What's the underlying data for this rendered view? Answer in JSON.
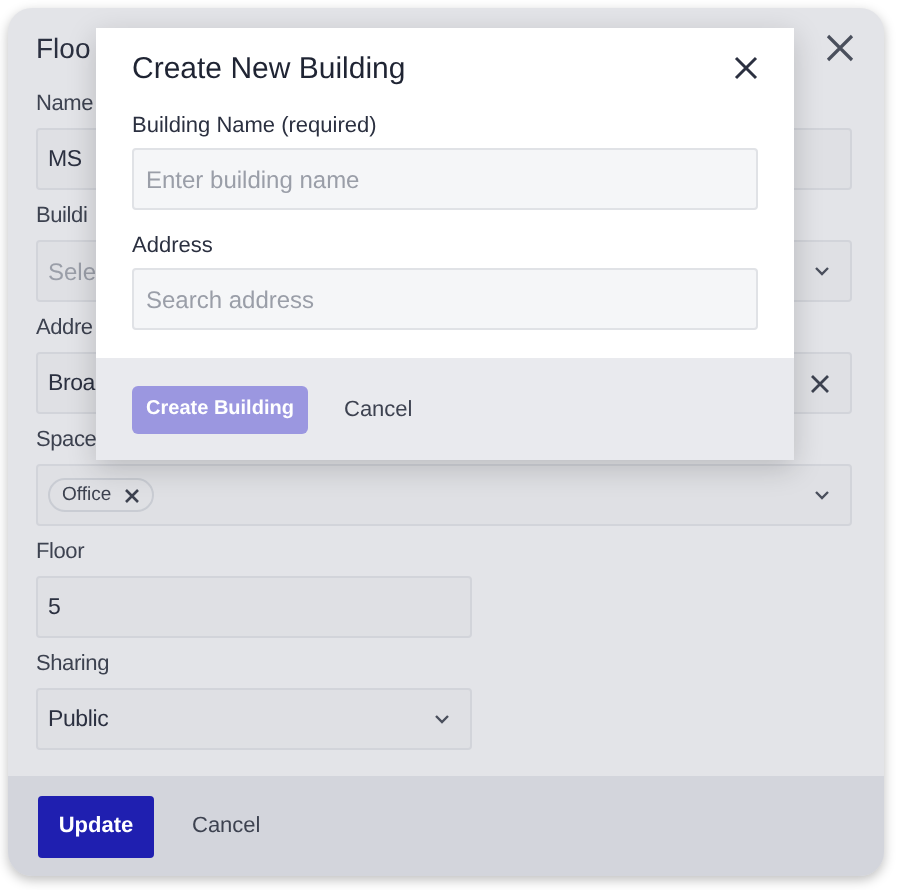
{
  "dialog": {
    "title": "Floo",
    "fields": [
      {
        "kind": "text",
        "label": "Name",
        "value": "MS"
      },
      {
        "kind": "select",
        "label": "Buildi",
        "placeholder": "Sele"
      },
      {
        "kind": "clearable",
        "label": "Addre",
        "value": "Broa"
      },
      {
        "kind": "multiselect",
        "label": "Space",
        "tags": [
          "Office"
        ]
      },
      {
        "kind": "text",
        "label": "Floor",
        "value": "5",
        "narrow": true
      },
      {
        "kind": "select",
        "label": "Sharing",
        "value": "Public",
        "narrow": true
      }
    ],
    "buttons": [
      {
        "label": "Update",
        "kind": "primary"
      },
      {
        "label": "Cancel",
        "kind": "plain"
      }
    ]
  },
  "modal": {
    "title": "Create New Building",
    "fields": [
      {
        "label": "Building Name (required)",
        "placeholder": "Enter building name"
      },
      {
        "label": "Address",
        "placeholder": "Search address"
      }
    ],
    "buttons": [
      {
        "label": "Create Building",
        "kind": "primary",
        "disabled": true
      },
      {
        "label": "Cancel",
        "kind": "plain"
      }
    ]
  }
}
